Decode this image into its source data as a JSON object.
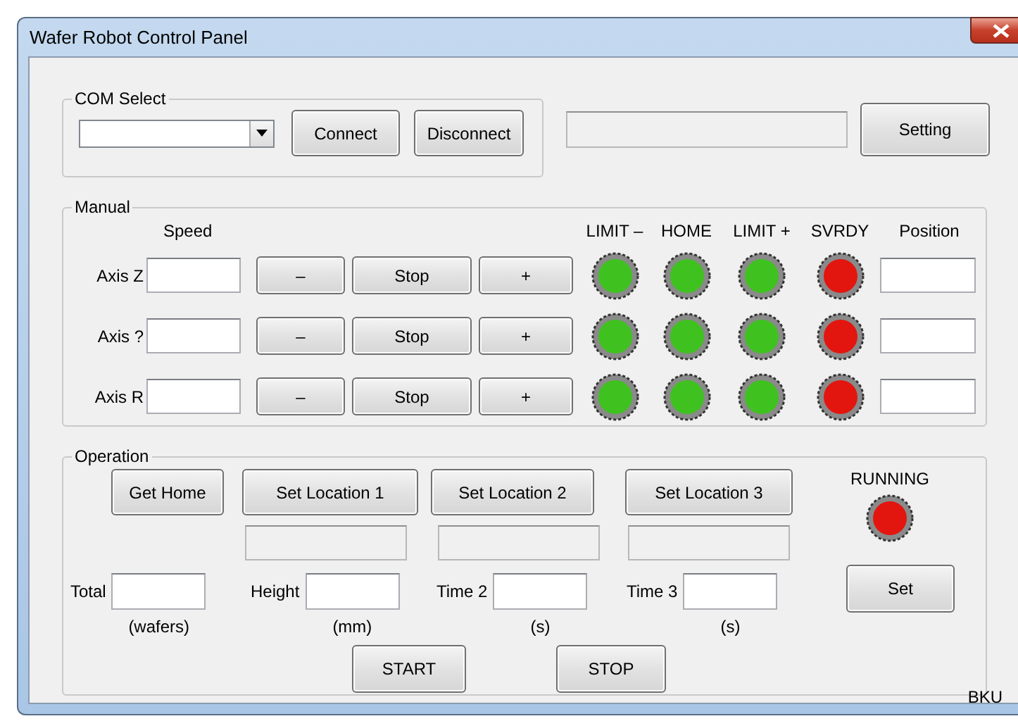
{
  "window": {
    "title": "Wafer Robot Control Panel"
  },
  "com_select": {
    "label": "COM Select",
    "buttons": [
      "Connect",
      "Disconnect"
    ]
  },
  "setting_button": "Setting",
  "manual": {
    "label": "Manual",
    "speed_header": "Speed",
    "indicator_headers": [
      "LIMIT –",
      "HOME",
      "LIMIT +",
      "SVRDY"
    ],
    "position_header": "Position",
    "axes": [
      {
        "label": "Axis Z",
        "buttons": [
          "–",
          "Stop",
          "+"
        ],
        "indicators": [
          {
            "color": "#3fc21f"
          },
          {
            "color": "#3fc21f"
          },
          {
            "color": "#3fc21f"
          },
          {
            "color": "#e3150f"
          }
        ]
      },
      {
        "label": "Axis ?",
        "buttons": [
          "–",
          "Stop",
          "+"
        ],
        "indicators": [
          {
            "color": "#3fc21f"
          },
          {
            "color": "#3fc21f"
          },
          {
            "color": "#3fc21f"
          },
          {
            "color": "#e3150f"
          }
        ]
      },
      {
        "label": "Axis R",
        "buttons": [
          "–",
          "Stop",
          "+"
        ],
        "indicators": [
          {
            "color": "#3fc21f"
          },
          {
            "color": "#3fc21f"
          },
          {
            "color": "#3fc21f"
          },
          {
            "color": "#e3150f"
          }
        ]
      }
    ]
  },
  "operation": {
    "label": "Operation",
    "location_buttons": [
      "Get Home",
      "Set Location 1",
      "Set Location 2",
      "Set Location 3"
    ],
    "indicator": {
      "label": "RUNNING",
      "color": "#e3150f"
    },
    "params": [
      {
        "label": "Total",
        "unit": "(wafers)"
      },
      {
        "label": "Height",
        "unit": "(mm)"
      },
      {
        "label": "Time 2",
        "unit": "(s)"
      },
      {
        "label": "Time 3",
        "unit": "(s)"
      }
    ],
    "set_button": "Set",
    "start_button": "START",
    "stop_button": "STOP"
  },
  "footer_label": "BKU"
}
